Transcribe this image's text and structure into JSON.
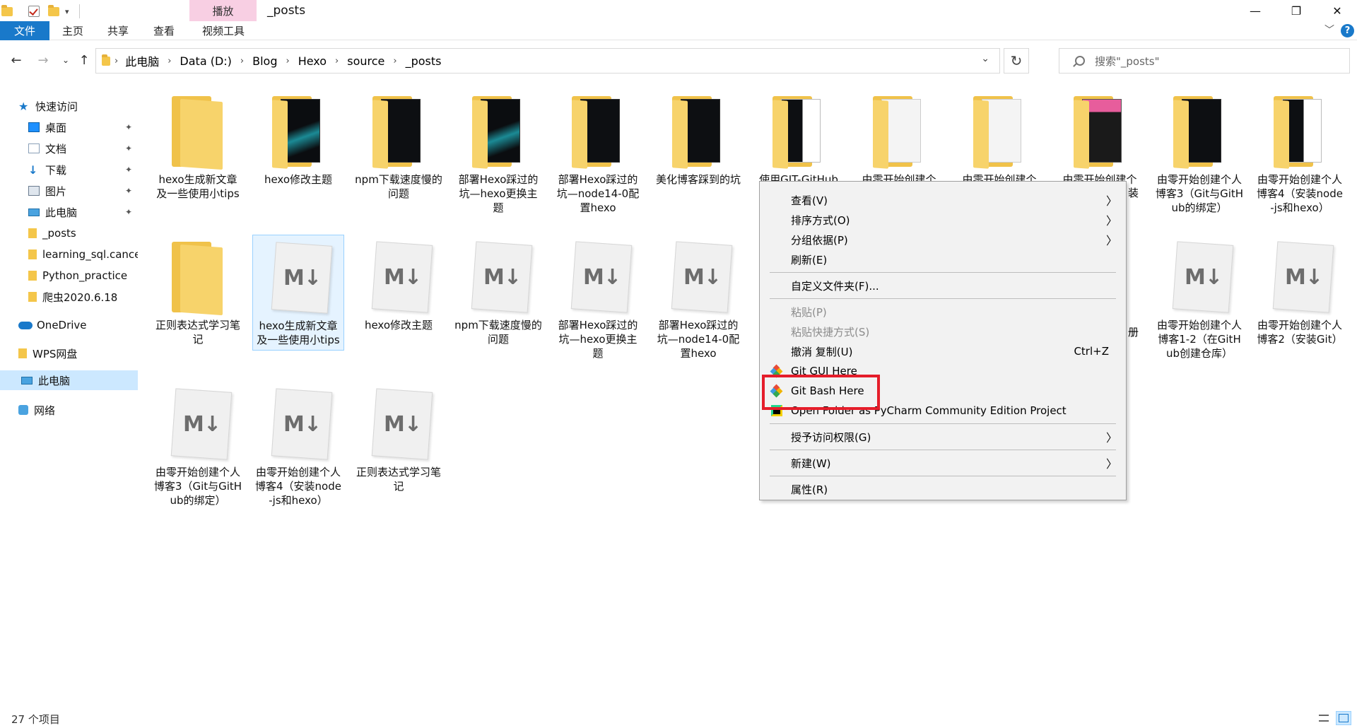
{
  "window": {
    "title": "_posts",
    "contextual_tab": "播放",
    "controls": {
      "minimize": "—",
      "maximize": "❐",
      "close": "✕"
    }
  },
  "ribbon": {
    "tabs": [
      "文件",
      "主页",
      "共享",
      "查看",
      "视频工具"
    ],
    "help": "?"
  },
  "address": {
    "crumbs": [
      "此电脑",
      "Data (D:)",
      "Blog",
      "Hexo",
      "source",
      "_posts"
    ],
    "search_placeholder": "搜索\"_posts\""
  },
  "nav": {
    "quick_access": "快速访问",
    "items": [
      {
        "label": "桌面",
        "icon": "desktop-icon",
        "pinned": true
      },
      {
        "label": "文档",
        "icon": "document-icon",
        "pinned": true
      },
      {
        "label": "下载",
        "icon": "download-icon",
        "pinned": true
      },
      {
        "label": "图片",
        "icon": "picture-icon",
        "pinned": true
      },
      {
        "label": "此电脑",
        "icon": "computer-icon",
        "pinned": true
      },
      {
        "label": "_posts",
        "icon": "folder-icon"
      },
      {
        "label": "learning_sql.cance",
        "icon": "folder-icon"
      },
      {
        "label": "Python_practice",
        "icon": "folder-icon"
      },
      {
        "label": "爬虫2020.6.18",
        "icon": "folder-icon"
      }
    ],
    "onedrive": "OneDrive",
    "wps": "WPS网盘",
    "this_pc": "此电脑",
    "network": "网络"
  },
  "files": [
    {
      "name": "hexo生成新文章及一些使用小tips",
      "type": "folder",
      "preview": "none"
    },
    {
      "name": "hexo修改主题",
      "type": "folder",
      "preview": "teal"
    },
    {
      "name": "npm下载速度慢的问题",
      "type": "folder",
      "preview": "dark"
    },
    {
      "name": "部署Hexo踩过的坑—hexo更换主题",
      "type": "folder",
      "preview": "teal"
    },
    {
      "name": "部署Hexo踩过的坑—node14-0配置hexo",
      "type": "folder",
      "preview": "dark"
    },
    {
      "name": "美化博客踩到的坑",
      "type": "folder",
      "preview": "dark"
    },
    {
      "name": "使用GIT-GitHub",
      "type": "folder",
      "preview": "mixed"
    },
    {
      "name": "由零开始创建个",
      "type": "folder",
      "preview": "light"
    },
    {
      "name": "由零开始创建个",
      "type": "folder",
      "preview": "light"
    },
    {
      "name": "由零开始创建个",
      "type": "folder",
      "preview": "pink"
    },
    {
      "name": "由零开始创建个人博客3（Git与GitHub的绑定）",
      "type": "folder",
      "preview": "dark"
    },
    {
      "name": "由零开始创建个人博客4（安装node-js和hexo）",
      "type": "folder",
      "preview": "mixed"
    },
    {
      "name": "正则表达式学习笔记",
      "type": "folder",
      "preview": "none"
    },
    {
      "name": "hexo生成新文章及一些使用小tips",
      "type": "md",
      "selected": true
    },
    {
      "name": "hexo修改主题",
      "type": "md"
    },
    {
      "name": "npm下载速度慢的问题",
      "type": "md"
    },
    {
      "name": "部署Hexo踩过的坑—hexo更换主题",
      "type": "md"
    },
    {
      "name": "部署Hexo踩过的坑—node14-0配置hexo",
      "type": "md"
    },
    {
      "name": "由零开始创建个人博客1-2（在GitHub创建仓库）",
      "type": "md"
    },
    {
      "name": "由零开始创建个人博客2（安装Git）",
      "type": "md"
    },
    {
      "name": "由零开始创建个人博客3（Git与GitHub的绑定）",
      "type": "md"
    },
    {
      "name": "由零开始创建个人博客4（安装node-js和hexo）",
      "type": "md"
    },
    {
      "name": "正则表达式学习笔记",
      "type": "md"
    }
  ],
  "partial_labels": {
    "install": "装",
    "reg": "册"
  },
  "md_glyph": "M↓",
  "context_menu": {
    "view": "查看(V)",
    "sort": "排序方式(O)",
    "group": "分组依据(P)",
    "refresh": "刷新(E)",
    "customize": "自定义文件夹(F)...",
    "paste": "粘贴(P)",
    "paste_shortcut": "粘贴快捷方式(S)",
    "undo": "撤消 复制(U)",
    "undo_shortcut": "Ctrl+Z",
    "git_gui": "Git GUI Here",
    "git_bash": "Git Bash Here",
    "pycharm": "Open Folder as PyCharm Community Edition Project",
    "grant_access": "授予访问权限(G)",
    "new": "新建(W)",
    "properties": "属性(R)"
  },
  "status": {
    "item_count": "27 个项目"
  },
  "colors": {
    "accent": "#1979ca",
    "highlight": "#e51d2a",
    "selection": "#cce8ff"
  }
}
